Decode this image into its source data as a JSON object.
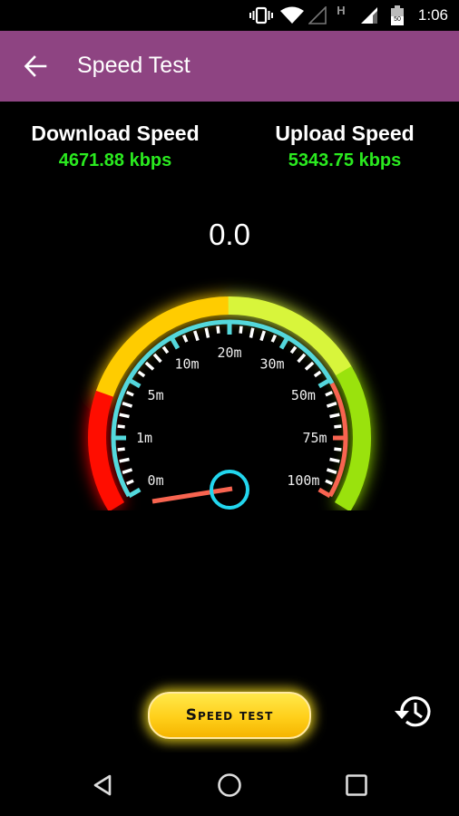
{
  "status_bar": {
    "time": "1:06",
    "icons": [
      "vibrate-icon",
      "wifi-icon",
      "signal-empty-icon",
      "hspa-icon",
      "signal-icon",
      "battery-icon"
    ],
    "network_type": "H",
    "battery_level": "50"
  },
  "app_bar": {
    "title": "Speed Test",
    "back_icon": "arrow-left-icon",
    "color": "#8e4482"
  },
  "results": {
    "download": {
      "label": "Download Speed",
      "value": "4671.88 kbps"
    },
    "upload": {
      "label": "Upload Speed",
      "value": "5343.75 kbps"
    },
    "value_color": "#2aea1f"
  },
  "gauge": {
    "current_value": "0.0",
    "needle_value": 0,
    "scale_labels": [
      "0m",
      "1m",
      "5m",
      "10m",
      "20m",
      "30m",
      "50m",
      "75m",
      "100m"
    ],
    "zone_colors": [
      "#ff0f00",
      "#ffcc00",
      "#d8f53a",
      "#9ae20a"
    ],
    "scale_color": "#54d8dc",
    "high_scale_color": "#f86450",
    "needle_color": "#f86450",
    "hub_color": "#22d6ee"
  },
  "actions": {
    "speed_test_button": "Speed test",
    "history_icon": "history-icon"
  },
  "nav_bar": {
    "items": [
      "back-icon",
      "home-icon",
      "recents-icon"
    ]
  }
}
